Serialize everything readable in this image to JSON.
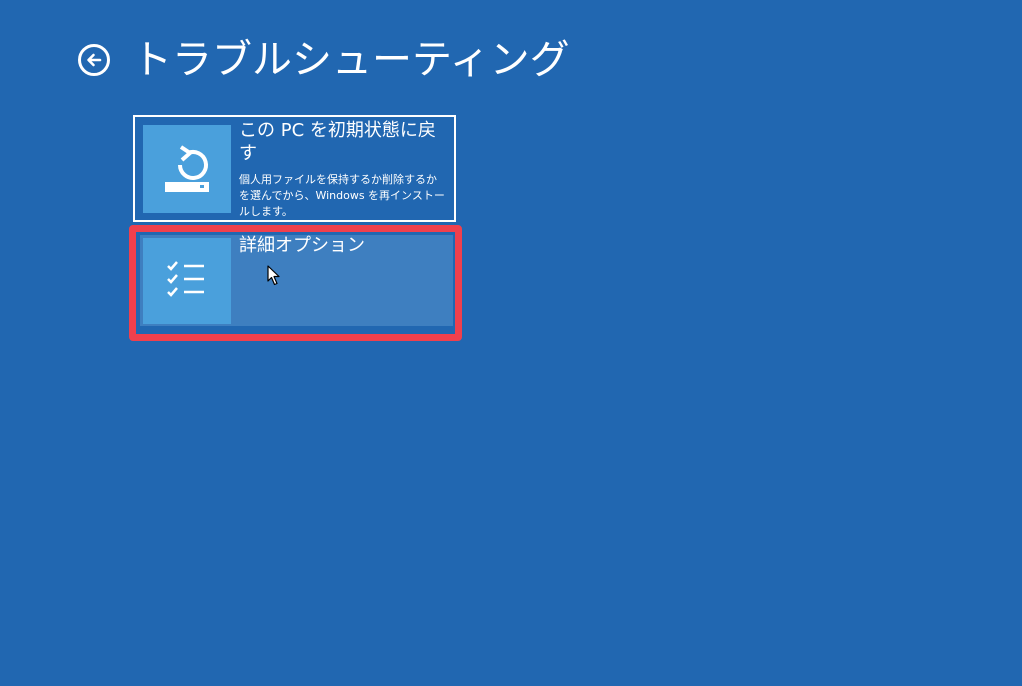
{
  "header": {
    "title": "トラブルシューティング"
  },
  "tiles": {
    "reset": {
      "title": "この PC を初期状態に戻す",
      "description": "個人用ファイルを保持するか削除するかを選んでから、Windows を再インストールします。",
      "icon": "reset-pc-icon"
    },
    "advanced": {
      "title": "詳細オプション",
      "icon": "checklist-icon"
    }
  },
  "colors": {
    "background": "#2167b1",
    "icon_box": "#4aa0dc",
    "selected_tile": "#3e7fc0",
    "highlight": "#f0404d"
  }
}
